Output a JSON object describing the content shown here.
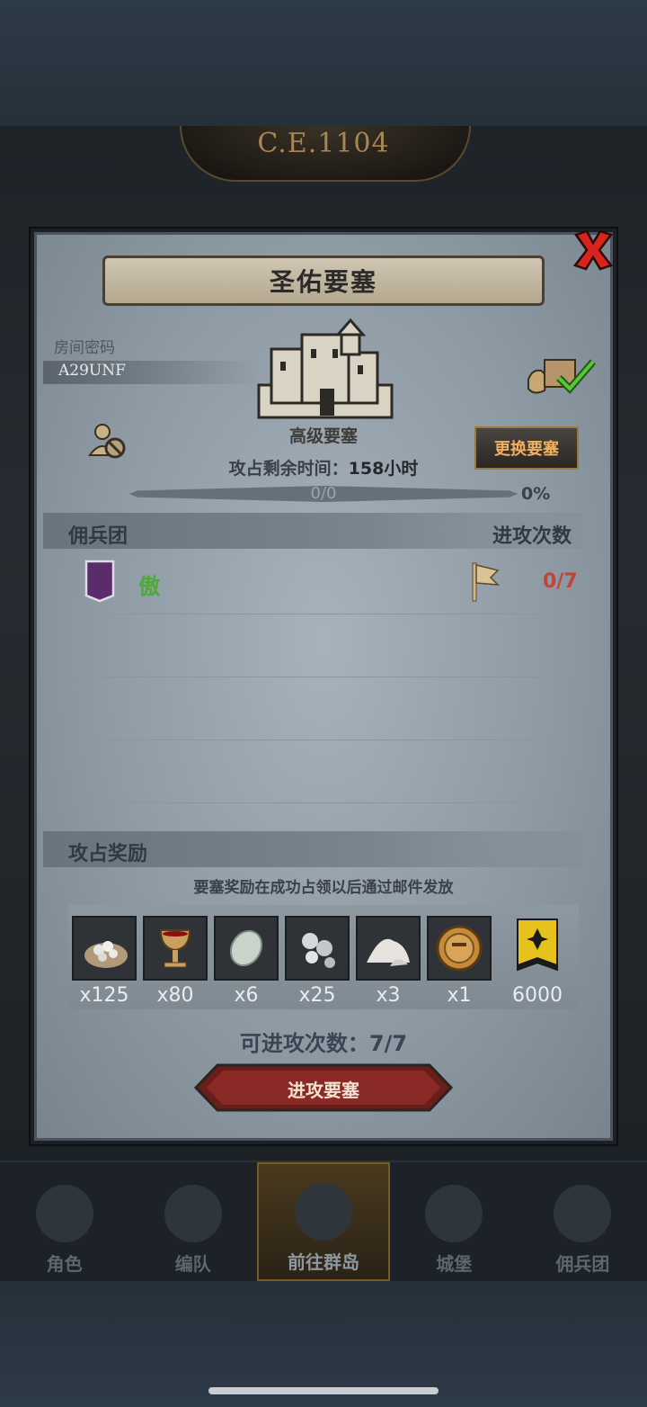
{
  "background": {
    "era_label": "C.E.1104"
  },
  "modal": {
    "title": "圣佑要塞",
    "room_code_label": "房间密码",
    "room_code": "A29UNF",
    "fortress_type": "高级要塞",
    "time_remaining_label": "攻占剩余时间：",
    "time_remaining_value": "158小时",
    "progress_text": "0/0",
    "progress_percent": "0%",
    "progress_fraction": 0,
    "change_fortress_button": "更换要塞",
    "mercenary_section": "佣兵团",
    "attack_count_section": "进攻次数",
    "guild": {
      "name": "傲",
      "attacks": "0/7"
    },
    "reward_section": "攻占奖励",
    "reward_note": "要塞奖励在成功占领以后通过邮件发放",
    "rewards": [
      {
        "icon": "ore-bag-icon",
        "qty": "x125"
      },
      {
        "icon": "goblet-icon",
        "qty": "x80"
      },
      {
        "icon": "gem-stone-icon",
        "qty": "x6"
      },
      {
        "icon": "silver-orbs-icon",
        "qty": "x25"
      },
      {
        "icon": "salt-pile-icon",
        "qty": "x3"
      },
      {
        "icon": "knight-medal-icon",
        "qty": "x1"
      },
      {
        "icon": "guild-banner-icon",
        "qty": "6000"
      }
    ],
    "remaining_attacks_label": "可进攻次数：7/7",
    "attack_button": "进攻要塞"
  },
  "bottom_nav": {
    "items": [
      "角色",
      "编队",
      "前往群岛",
      "城堡",
      "佣兵团"
    ],
    "active_index": 2
  },
  "colors": {
    "accent_gold": "#f0b060",
    "guild_green": "#4fa83a",
    "attack_red": "#c0443c",
    "close_red": "#d8241c"
  }
}
